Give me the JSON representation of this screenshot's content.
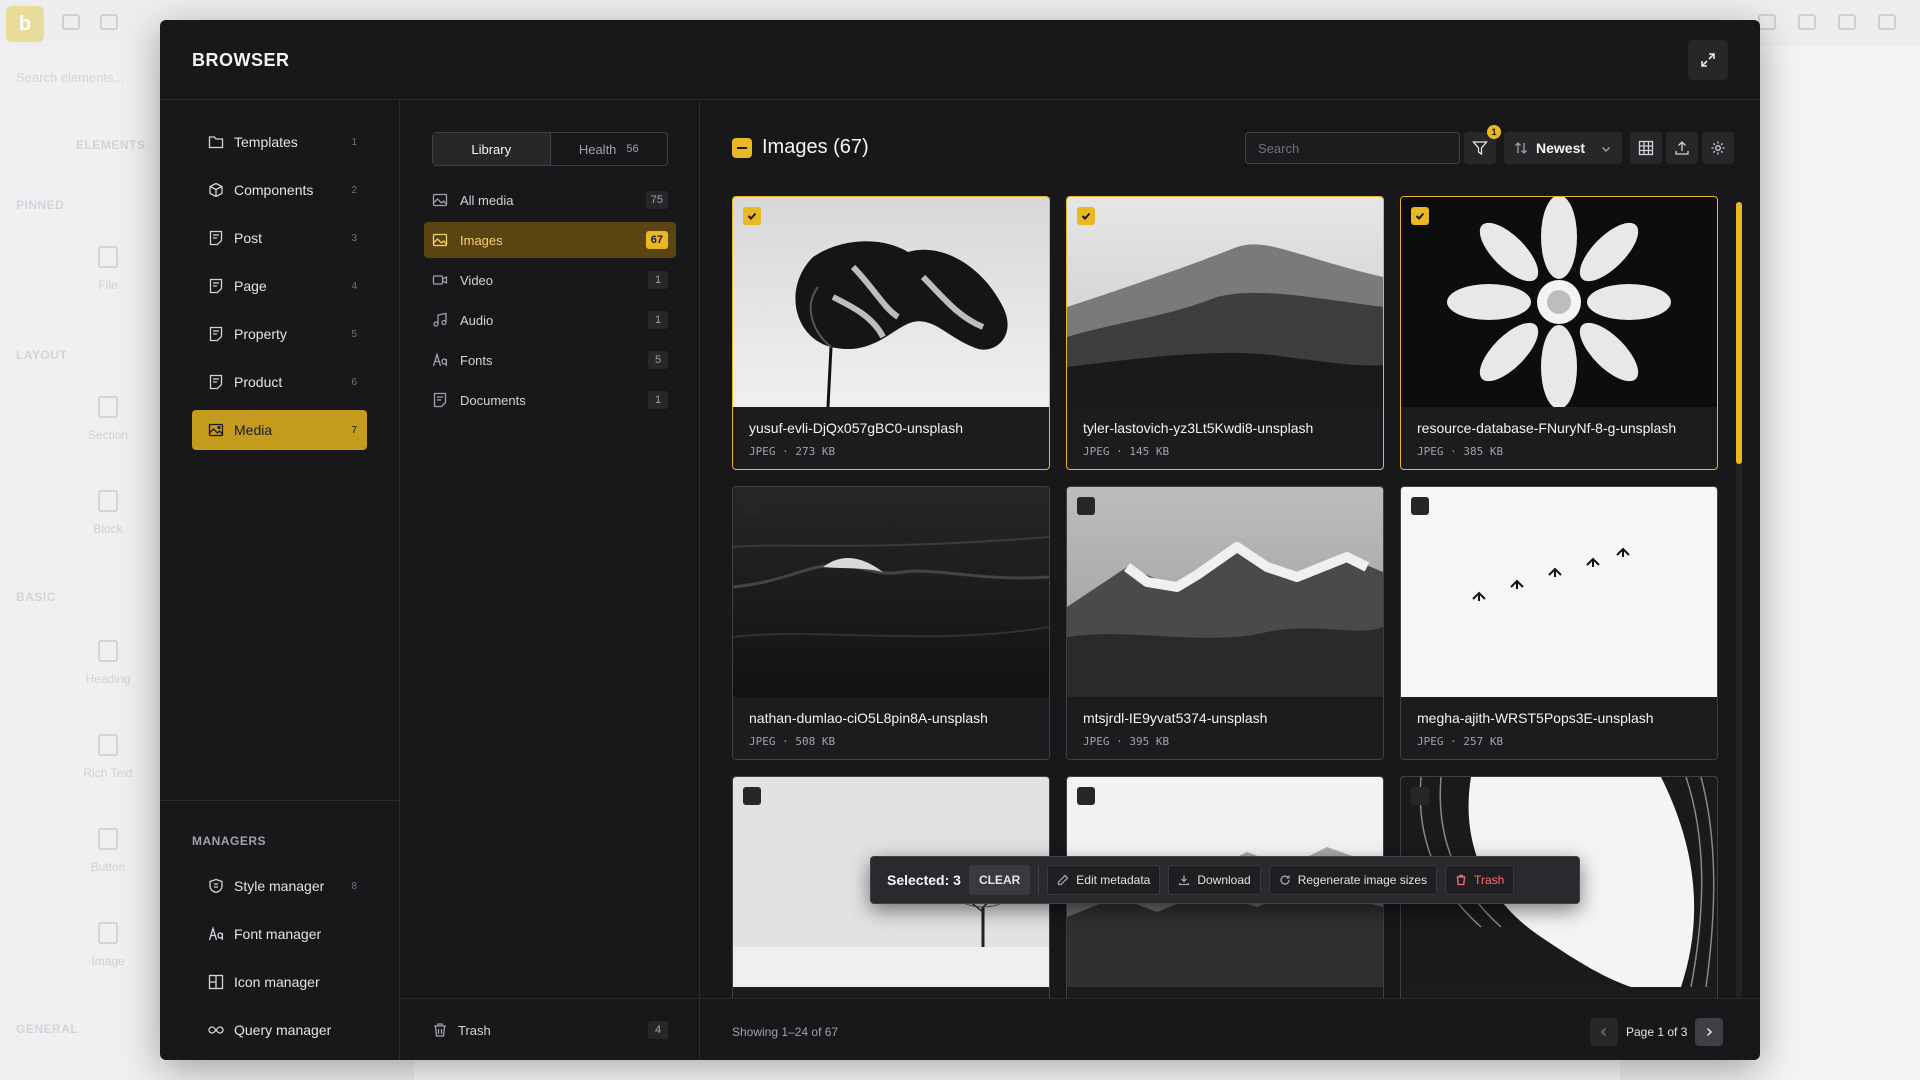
{
  "background": {
    "logo": "b",
    "search_placeholder": "Search elements...",
    "tab_label": "ELEMENTS",
    "sections": [
      "PINNED",
      "LAYOUT",
      "BASIC",
      "GENERAL"
    ],
    "items": [
      "File",
      "Section",
      "Block",
      "Heading",
      "Rich Text",
      "Button",
      "Image"
    ]
  },
  "modal": {
    "title": "BROWSER",
    "expand_icon": "expand-icon"
  },
  "nav": {
    "items": [
      {
        "label": "Templates",
        "count": "1",
        "icon": "template-icon"
      },
      {
        "label": "Components",
        "count": "2",
        "icon": "cube-icon"
      },
      {
        "label": "Post",
        "count": "3",
        "icon": "document-icon"
      },
      {
        "label": "Page",
        "count": "4",
        "icon": "document-icon"
      },
      {
        "label": "Property",
        "count": "5",
        "icon": "document-icon"
      },
      {
        "label": "Product",
        "count": "6",
        "icon": "document-icon"
      },
      {
        "label": "Media",
        "count": "7",
        "icon": "image-icon",
        "active": true
      }
    ],
    "managers_label": "MANAGERS",
    "managers": [
      {
        "label": "Style manager",
        "count": "8",
        "icon": "shield-icon"
      },
      {
        "label": "Font manager",
        "icon": "font-icon"
      },
      {
        "label": "Icon manager",
        "icon": "icon-grid-icon"
      },
      {
        "label": "Query manager",
        "icon": "infinity-icon"
      }
    ]
  },
  "library": {
    "tabs": [
      {
        "label": "Library",
        "active": true
      },
      {
        "label": "Health",
        "badge": "56"
      }
    ],
    "types": [
      {
        "label": "All media",
        "count": "75",
        "icon": "image-icon"
      },
      {
        "label": "Images",
        "count": "67",
        "icon": "image-icon",
        "active": true
      },
      {
        "label": "Video",
        "count": "1",
        "icon": "video-icon"
      },
      {
        "label": "Audio",
        "count": "1",
        "icon": "music-icon"
      },
      {
        "label": "Fonts",
        "count": "5",
        "icon": "font-icon"
      },
      {
        "label": "Documents",
        "count": "1",
        "icon": "document-icon"
      }
    ],
    "trash": {
      "label": "Trash",
      "count": "4"
    }
  },
  "content": {
    "title": "Images (67)",
    "search_placeholder": "Search",
    "filter_count": "1",
    "sort_label": "Newest",
    "images": [
      {
        "name": "yusuf-evli-DjQx057gBC0-unsplash",
        "type": "JPEG",
        "size": "273 KB",
        "selected": true
      },
      {
        "name": "tyler-lastovich-yz3Lt5Kwdi8-unsplash",
        "type": "JPEG",
        "size": "145 KB",
        "selected": true
      },
      {
        "name": "resource-database-FNuryNf-8-g-unsplash",
        "type": "JPEG",
        "size": "385 KB",
        "selected": true
      },
      {
        "name": "nathan-dumlao-ciO5L8pin8A-unsplash",
        "type": "JPEG",
        "size": "508 KB",
        "selected": false
      },
      {
        "name": "mtsjrdl-IE9yvat5374-unsplash",
        "type": "JPEG",
        "size": "395 KB",
        "selected": false
      },
      {
        "name": "megha-ajith-WRST5Pops3E-unsplash",
        "type": "JPEG",
        "size": "257 KB",
        "selected": false
      },
      {
        "name": "",
        "type": "",
        "size": "",
        "selected": false
      },
      {
        "name": "",
        "type": "",
        "size": "",
        "selected": false
      },
      {
        "name": "",
        "type": "",
        "size": "",
        "selected": false
      }
    ],
    "selection_bar": {
      "selected_label": "Selected: 3",
      "clear": "CLEAR",
      "edit_metadata": "Edit metadata",
      "download": "Download",
      "regenerate": "Regenerate image sizes",
      "trash": "Trash"
    },
    "footer": {
      "showing": "Showing 1–24 of 67",
      "page_label": "Page 1 of 3"
    }
  }
}
